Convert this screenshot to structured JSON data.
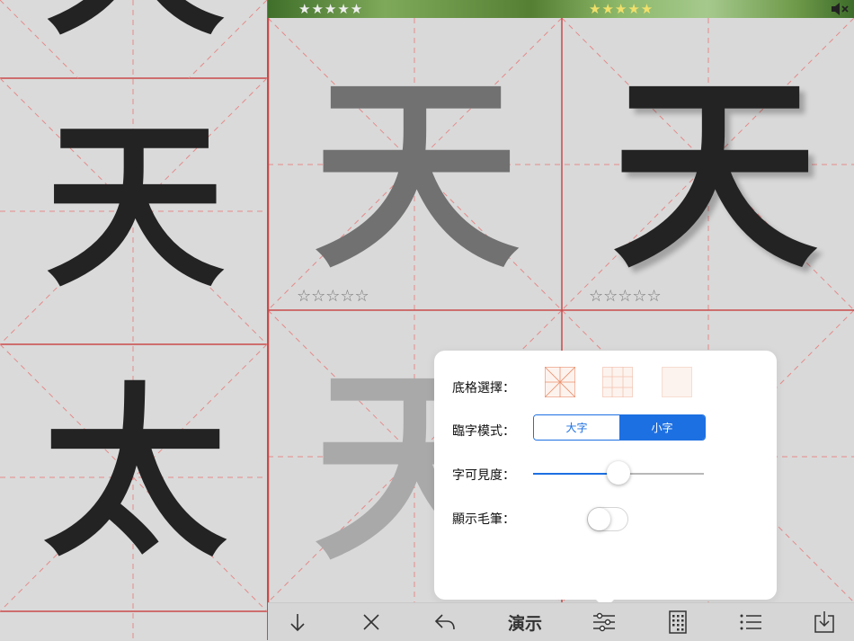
{
  "left_column": {
    "characters": [
      "天",
      "天",
      "太"
    ]
  },
  "practice_grid": {
    "model_character": "天",
    "cells": [
      {
        "character": "天",
        "style": "faded",
        "stars": "☆☆☆☆☆"
      },
      {
        "character": "天",
        "style": "written",
        "stars": "☆☆☆☆☆"
      },
      {
        "character": "天",
        "style": "faint",
        "stars": ""
      },
      {
        "character": "",
        "style": "empty",
        "stars": ""
      }
    ],
    "top_ratings": [
      "★★★★★",
      "★★★★★"
    ]
  },
  "banner": {
    "mute_icon": "speaker-mute-icon"
  },
  "popover": {
    "grid_label": "底格選擇：",
    "grid_options": [
      "米字格",
      "田字格",
      "空白格"
    ],
    "selected_grid": 0,
    "mode_label": "臨字模式：",
    "mode_options": [
      "大字",
      "小字"
    ],
    "selected_mode": 1,
    "visibility_label": "字可見度：",
    "visibility_value": 0.5,
    "brush_label": "顯示毛筆：",
    "brush_enabled": false
  },
  "toolbar": {
    "items": [
      {
        "name": "down-arrow-icon"
      },
      {
        "name": "close-icon"
      },
      {
        "name": "undo-icon"
      },
      {
        "name": "demo-button",
        "label": "演示"
      },
      {
        "name": "settings-sliders-icon"
      },
      {
        "name": "grid-book-icon"
      },
      {
        "name": "list-icon"
      },
      {
        "name": "save-download-icon"
      }
    ]
  },
  "colors": {
    "grid_red": "#c94a4a",
    "grid_dashed": "#e58a8a",
    "accent_blue": "#1d70e2",
    "ink": "#232323"
  }
}
